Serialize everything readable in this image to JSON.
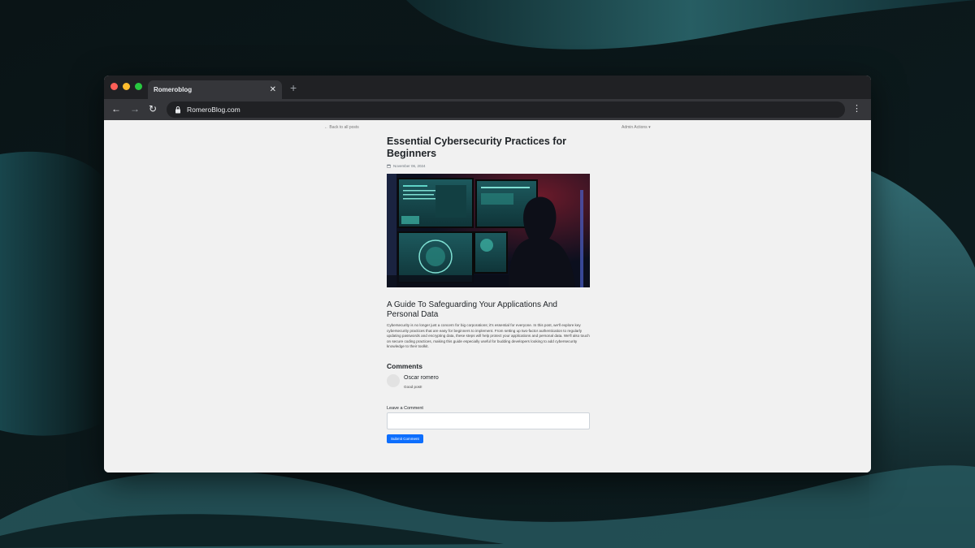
{
  "browser": {
    "tab_title": "Romeroblog",
    "tab_close": "✕",
    "new_tab": "+",
    "url": "RomeroBlog.com",
    "back": "←",
    "forward": "→",
    "reload": "↻",
    "menu": "⋮"
  },
  "page": {
    "back_link": "← Back to all posts",
    "admin_actions": "Admin Actions ▾",
    "title": "Essential Cybersecurity Practices for Beginners",
    "date": "November 06, 2024",
    "hero_image": "hacker-workstation-monitors",
    "subtitle": "A Guide To Safeguarding Your Applications And Personal Data",
    "body": "Cybersecurity is no longer just a concern for big corporations; it's essential for everyone. In this post, we'll explore key cybersecurity practices that are easy for beginners to implement. From setting up two-factor authentication to regularly updating passwords and encrypting data, these steps will help protect your applications and personal data. We'll also touch on secure coding practices, making this guide especially useful for budding developers looking to add cybersecurity knowledge to their toolkit."
  },
  "comments": {
    "heading": "Comments",
    "items": [
      {
        "author": "Oscar romero",
        "text": "Good post!"
      }
    ]
  },
  "comment_form": {
    "label": "Leave a Comment",
    "placeholder": "",
    "submit_label": "Submit Comment"
  },
  "colors": {
    "primary_button": "#0d6efd",
    "chrome_dark": "#202124",
    "chrome_tab": "#35363a"
  }
}
